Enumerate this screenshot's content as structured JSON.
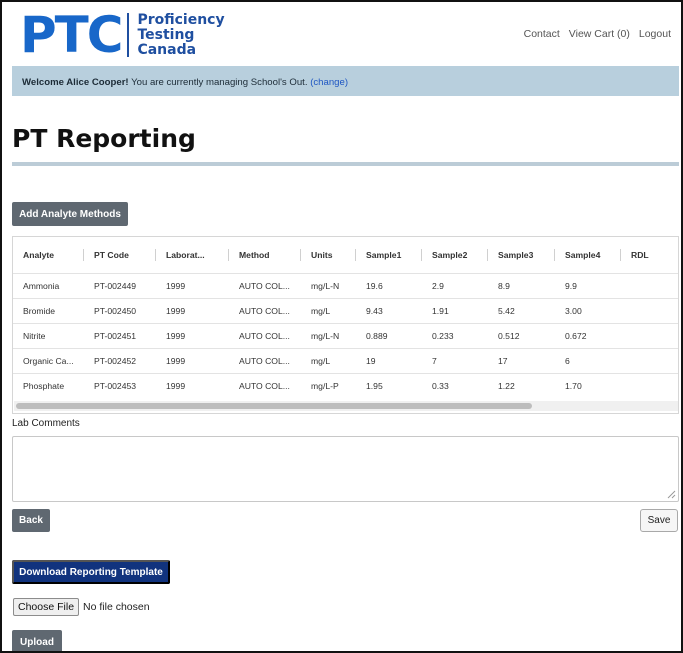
{
  "brand": {
    "mark": "PTC",
    "name_lines": [
      "Proficiency",
      "Testing",
      "Canada"
    ],
    "mark_color": "#1867c9",
    "name_color": "#1f4fa0"
  },
  "nav": {
    "contact": "Contact",
    "view_cart": "View Cart (0)",
    "logout": "Logout"
  },
  "welcome": {
    "prefix": "Welcome Alice Cooper!",
    "message": " You are currently managing School's Out. ",
    "change_link": "(change)"
  },
  "page": {
    "title": "PT Reporting"
  },
  "buttons": {
    "add_analyte_methods": "Add Analyte Methods",
    "back": "Back",
    "save": "Save",
    "download_template": "Download Reporting Template",
    "choose_file": "Choose File",
    "upload": "Upload"
  },
  "table": {
    "columns": [
      "Analyte",
      "PT Code",
      "Laborat...",
      "Method",
      "Units",
      "Sample1",
      "Sample2",
      "Sample3",
      "Sample4",
      "RDL"
    ],
    "rows": [
      [
        "Ammonia",
        "PT-002449",
        "1999",
        "AUTO COL...",
        "mg/L-N",
        "19.6",
        "2.9",
        "8.9",
        "9.9",
        ""
      ],
      [
        "Bromide",
        "PT-002450",
        "1999",
        "AUTO COL...",
        "mg/L",
        "9.43",
        "1.91",
        "5.42",
        "3.00",
        ""
      ],
      [
        "Nitrite",
        "PT-002451",
        "1999",
        "AUTO COL...",
        "mg/L-N",
        "0.889",
        "0.233",
        "0.512",
        "0.672",
        ""
      ],
      [
        "Organic Ca...",
        "PT-002452",
        "1999",
        "AUTO COL...",
        "mg/L",
        "19",
        "7",
        "17",
        "6",
        ""
      ],
      [
        "Phosphate",
        "PT-002453",
        "1999",
        "AUTO COL...",
        "mg/L-P",
        "1.95",
        "0.33",
        "1.22",
        "1.70",
        ""
      ]
    ]
  },
  "comments": {
    "label": "Lab Comments",
    "value": ""
  },
  "file": {
    "status": "No file chosen"
  },
  "colors": {
    "welcome_bg": "#b8cfdd",
    "dark_button": "#5f6871",
    "blue_button": "#11337e",
    "link": "#1f57c3"
  }
}
